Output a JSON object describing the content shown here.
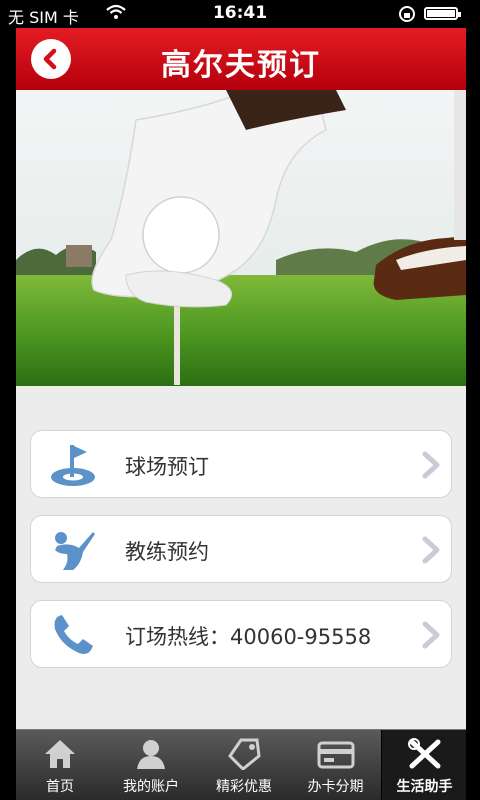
{
  "status_bar": {
    "carrier": "无 SIM 卡",
    "time": "16:41"
  },
  "header": {
    "title": "高尔夫预订",
    "back_icon": "chevron-left-icon"
  },
  "menu": {
    "items": [
      {
        "label": "球场预订",
        "icon": "golf-flag-icon"
      },
      {
        "label": "教练预约",
        "icon": "golfer-icon"
      },
      {
        "label": "订场热线：40060-95558",
        "icon": "phone-icon"
      }
    ]
  },
  "tabbar": {
    "tabs": [
      {
        "label": "首页",
        "icon": "home-icon"
      },
      {
        "label": "我的账户",
        "icon": "user-icon"
      },
      {
        "label": "精彩优惠",
        "icon": "tag-icon"
      },
      {
        "label": "办卡分期",
        "icon": "card-icon"
      },
      {
        "label": "生活助手",
        "icon": "tools-icon",
        "active": true
      }
    ]
  },
  "colors": {
    "header": "#d50f18",
    "icon_blue": "#5b92c9",
    "tabbar": "#3a3a3a"
  }
}
